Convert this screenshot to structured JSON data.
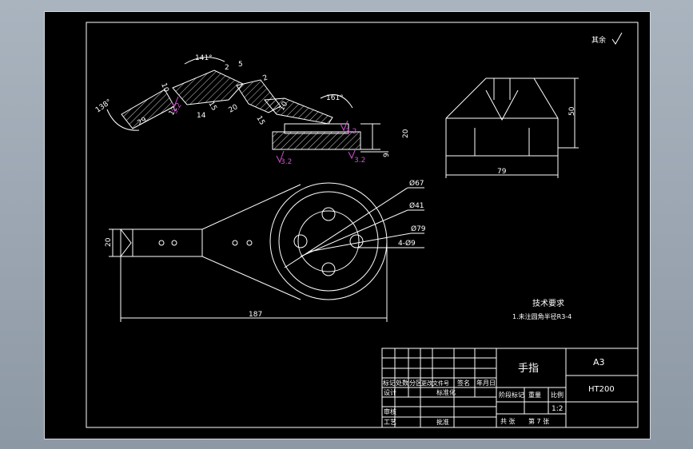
{
  "surface_mark": "其余",
  "section_dims": {
    "angle_left": "138°",
    "angle_top": "141°",
    "angle_right": "161°",
    "d29": "29",
    "d10": "10",
    "d12": "12",
    "d2": "2",
    "d5": "5",
    "d14": "14",
    "d15a": "15",
    "d20": "20",
    "d15b": "15",
    "d2b": "2",
    "d10b": "10",
    "d20v": "20",
    "d9": "9",
    "rough32a": "3.2",
    "rough32b": "3.2",
    "rough32c": "3.2",
    "rough32d": "3.2"
  },
  "side_view": {
    "height": "50",
    "width": "79"
  },
  "plan_view": {
    "phi67": "Ø67",
    "phi41": "Ø41",
    "phi79": "Ø79",
    "holes": "4-Ø9",
    "height20": "20",
    "length187": "187"
  },
  "tech_req": {
    "title": "技术要求",
    "line1": "1.未注圆角半径R3-4"
  },
  "title_block": {
    "part_name": "手指",
    "sheet_size": "A3",
    "material": "HT200",
    "rev_headers": [
      "标记",
      "处数",
      "分区",
      "更改文件号",
      "签名",
      "年月日"
    ],
    "design": "设计",
    "standardize": "标准化",
    "check": "审核",
    "process": "工艺",
    "approve": "批准",
    "stage_mark": "阶段标记",
    "weight": "重量",
    "scale": "比例",
    "scale_value": "1:2",
    "sheets": "共 张",
    "sheet_no": "第 7 张"
  }
}
